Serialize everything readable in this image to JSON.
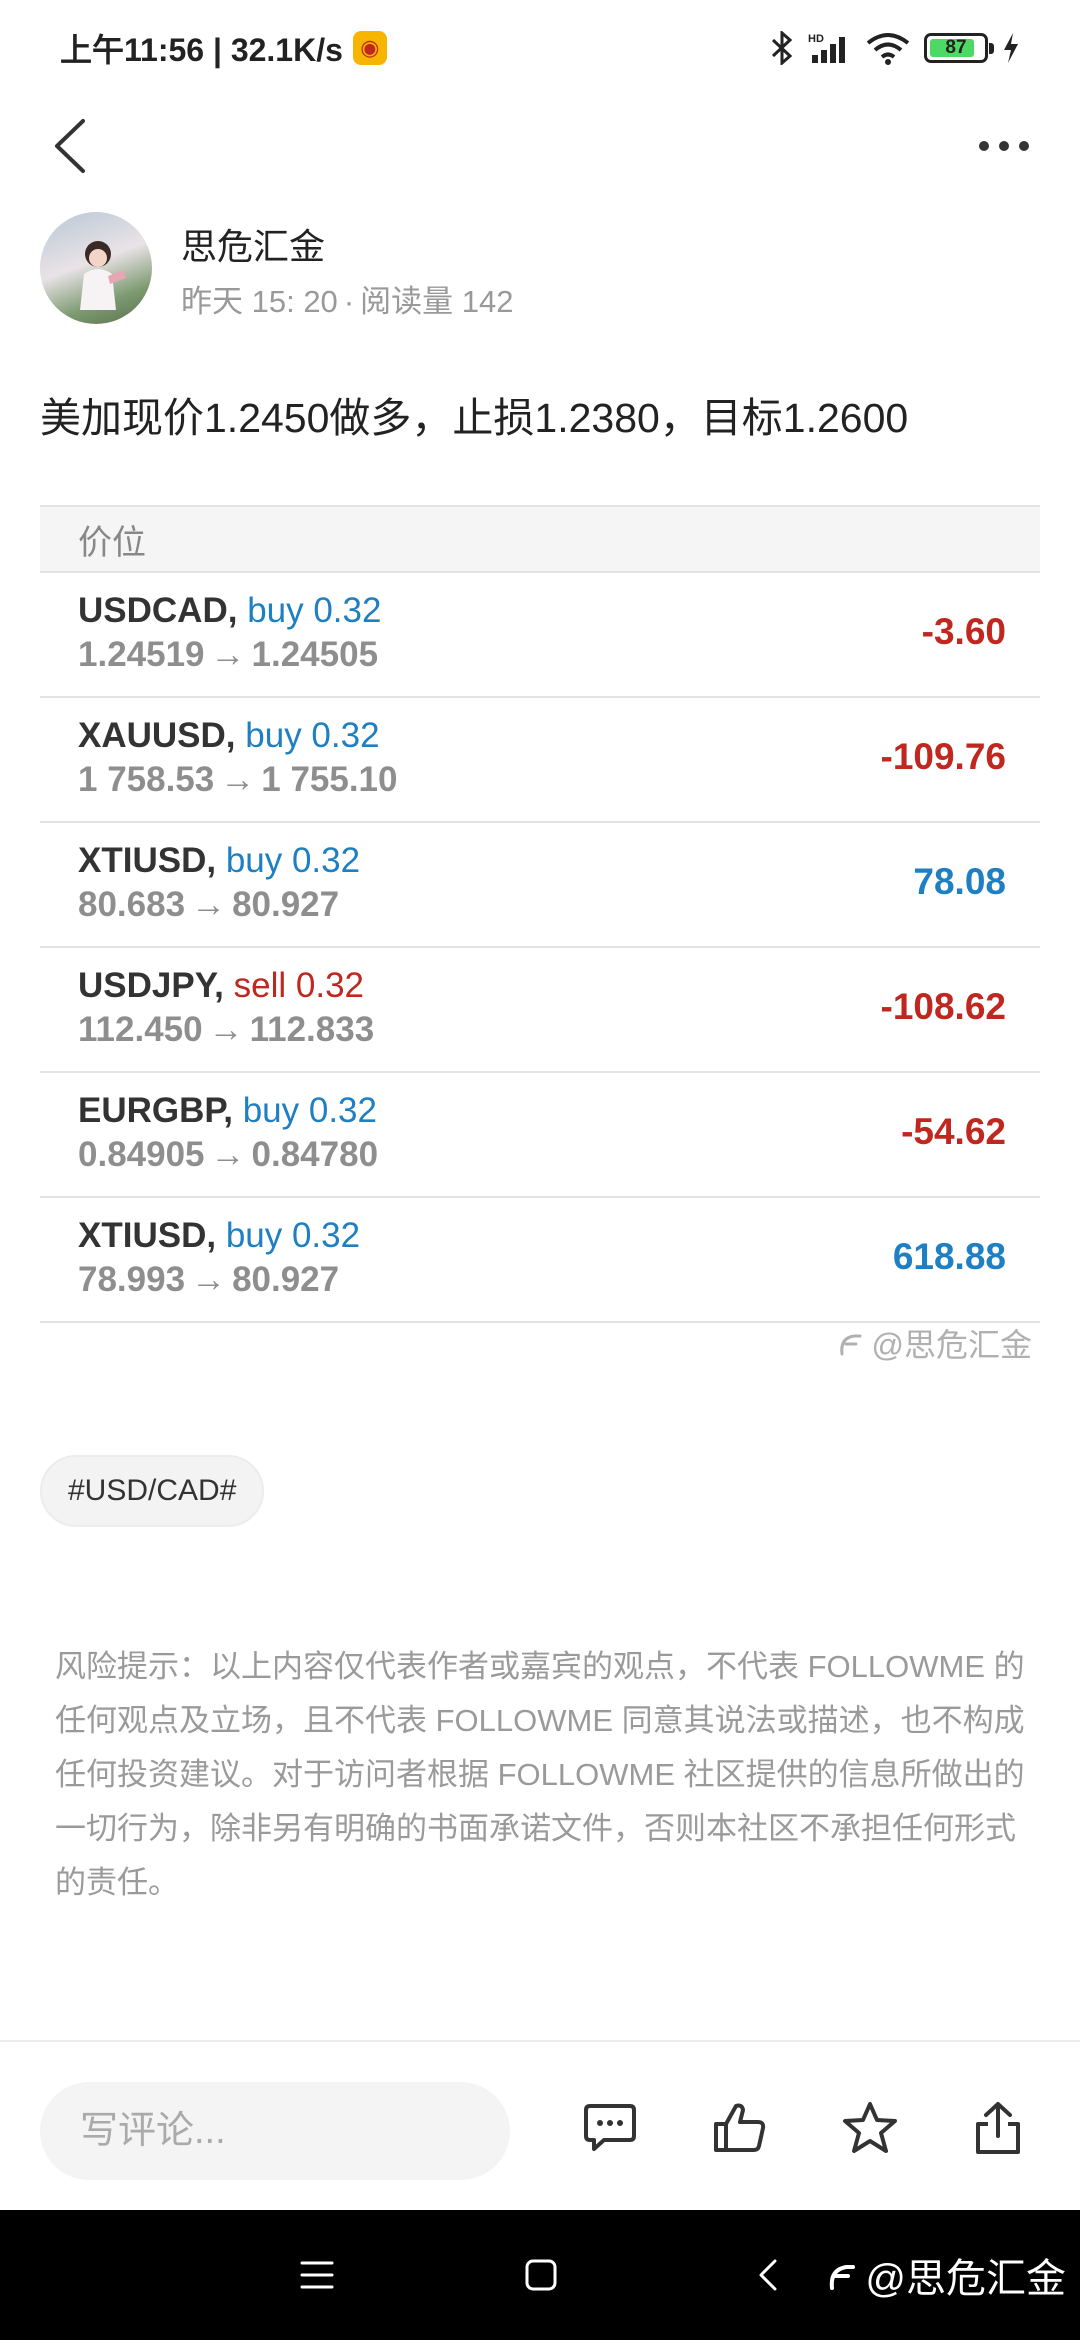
{
  "status_bar": {
    "time_speed": "上午11:56 | 32.1K/s",
    "battery": "87",
    "battery_level": 0.87
  },
  "author": {
    "name": "思危汇金",
    "date": "昨天 15: 20",
    "separator": "·",
    "reads": "阅读量 142"
  },
  "post": {
    "text": "美加现价1.2450做多，止损1.2380，目标1.2600"
  },
  "table": {
    "header": "价位",
    "rows": [
      {
        "symbol": "USDCAD,",
        "side": "buy 0.32",
        "open": "1.24519",
        "arrow": "→",
        "close": "1.24505",
        "profit": "-3.60"
      },
      {
        "symbol": "XAUUSD,",
        "side": "buy 0.32",
        "open": "1 758.53",
        "arrow": "→",
        "close": "1 755.10",
        "profit": "-109.76"
      },
      {
        "symbol": "XTIUSD,",
        "side": "buy 0.32",
        "open": "80.683",
        "arrow": "→",
        "close": "80.927",
        "profit": "78.08"
      },
      {
        "symbol": "USDJPY,",
        "side": "sell 0.32",
        "open": "112.450",
        "arrow": "→",
        "close": "112.833",
        "profit": "-108.62"
      },
      {
        "symbol": "EURGBP,",
        "side": "buy 0.32",
        "open": "0.84905",
        "arrow": "→",
        "close": "0.84780",
        "profit": "-54.62"
      },
      {
        "symbol": "XTIUSD,",
        "side": "buy 0.32",
        "open": "78.993",
        "arrow": "→",
        "close": "80.927",
        "profit": "618.88"
      }
    ]
  },
  "watermark": "@思危汇金",
  "tag": "#USD/CAD#",
  "disclaimer": "风险提示：以上内容仅代表作者或嘉宾的观点，不代表 FOLLOWME 的任何观点及立场，且不代表 FOLLOWME 同意其说法或描述，也不构成任何投资建议。对于访问者根据 FOLLOWME 社区提供的信息所做出的一切行为，除非另有明确的书面承诺文件，否则本社区不承担任何形式的责任。",
  "action_bar": {
    "comment_placeholder": "写评论..."
  },
  "system_nav": {
    "watermark": "@思危汇金"
  },
  "colors": {
    "buy": "#1e7fc2",
    "sell": "#c0271f",
    "profit_positive": "#1e7fc2",
    "profit_negative": "#c0271f"
  }
}
